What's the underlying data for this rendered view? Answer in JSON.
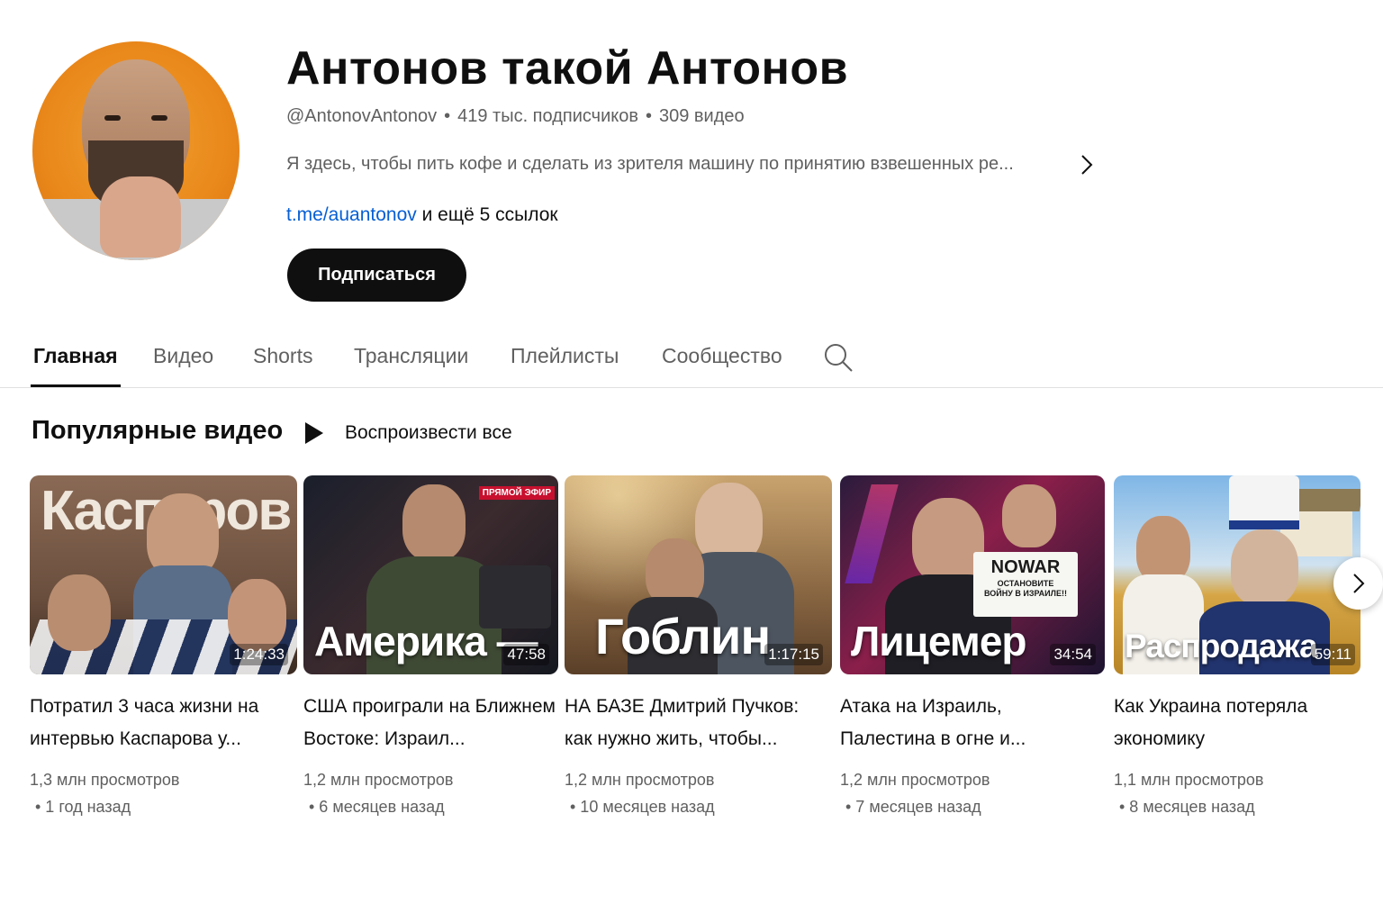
{
  "channel": {
    "title": "Антонов такой Антонов",
    "handle": "@AntonovAntonov",
    "subscribers": "419 тыс. подписчиков",
    "video_count": "309 видео",
    "description": "Я здесь, чтобы пить кофе и сделать из зрителя машину по принятию взвешенных ре...",
    "link_main": "t.me/auantonov",
    "link_more": "и ещё 5 ссылок",
    "subscribe_label": "Подписаться"
  },
  "tabs": [
    {
      "label": "Главная",
      "active": true
    },
    {
      "label": "Видео"
    },
    {
      "label": "Shorts"
    },
    {
      "label": "Трансляции"
    },
    {
      "label": "Плейлисты"
    },
    {
      "label": "Сообщество"
    }
  ],
  "section": {
    "title": "Популярные видео",
    "play_all": "Воспроизвести все"
  },
  "videos": [
    {
      "thumb_text": "Каспаров",
      "duration": "1:24:33",
      "title": "Потратил 3 часа жизни на интервью Каспарова у...",
      "views": "1,3 млн просмотров",
      "age": "• 1 год назад"
    },
    {
      "thumb_text": "Америка —",
      "badge": "ПРЯМОЙ ЭФИР",
      "duration": "47:58",
      "title": "США проиграли на Ближнем Востоке: Израил...",
      "views": "1,2 млн просмотров",
      "age": "• 6 месяцев назад"
    },
    {
      "thumb_text": "Гоблин",
      "duration": "1:17:15",
      "title": "НА БАЗЕ Дмитрий Пучков: как нужно жить, чтобы...",
      "views": "1,2 млн просмотров",
      "age": "• 10 месяцев назад"
    },
    {
      "thumb_text": "Лицемер",
      "sign_line1": "NOWAR",
      "sign_line2": "ОСТАНОВИТЕ ВОЙНУ В ИЗРАИЛЕ!!",
      "duration": "34:54",
      "title": "Атака на Израиль, Палестина в огне и...",
      "views": "1,2 млн просмотров",
      "age": "• 7 месяцев назад"
    },
    {
      "thumb_text": "Распродажа",
      "duration": "59:11",
      "title": "Как Украина потеряла экономику",
      "views": "1,1 млн просмотров",
      "age": "• 8 месяцев назад"
    }
  ],
  "colors": {
    "link": "#065fd4",
    "text_primary": "#0f0f0f",
    "text_secondary": "#606060",
    "avatar_bg": "#e9871a"
  },
  "icons": [
    "chevron-right-icon",
    "search-icon",
    "play-icon"
  ]
}
